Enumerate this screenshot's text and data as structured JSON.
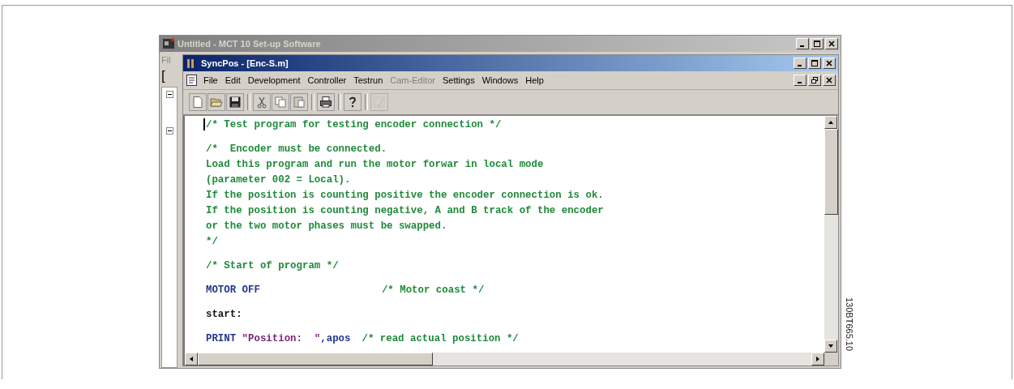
{
  "outer_window": {
    "title": "Untitled - MCT 10 Set-up Software",
    "active": false,
    "menu_fragment": "Fil",
    "toolbar_fragment": "["
  },
  "inner_window": {
    "title": "SyncPos - [Enc-S.m]",
    "active": true
  },
  "menu": [
    {
      "label": "File",
      "disabled": false
    },
    {
      "label": "Edit",
      "disabled": false
    },
    {
      "label": "Development",
      "disabled": false
    },
    {
      "label": "Controller",
      "disabled": false
    },
    {
      "label": "Testrun",
      "disabled": false
    },
    {
      "label": "Cam-Editor",
      "disabled": true
    },
    {
      "label": "Settings",
      "disabled": false
    },
    {
      "label": "Windows",
      "disabled": false
    },
    {
      "label": "Help",
      "disabled": false
    }
  ],
  "toolbar": [
    {
      "kind": "new",
      "separator_before": false,
      "disabled": false
    },
    {
      "kind": "open",
      "separator_before": false,
      "disabled": false
    },
    {
      "kind": "save",
      "separator_before": false,
      "disabled": false
    },
    {
      "kind": "cut",
      "separator_before": true,
      "disabled": false
    },
    {
      "kind": "copy",
      "separator_before": false,
      "disabled": false
    },
    {
      "kind": "paste",
      "separator_before": false,
      "disabled": false
    },
    {
      "kind": "print",
      "separator_before": true,
      "disabled": false
    },
    {
      "kind": "help",
      "separator_before": true,
      "disabled": false
    },
    {
      "kind": "check",
      "separator_before": true,
      "disabled": true
    }
  ],
  "editor": {
    "lines": [
      {
        "kind": "code",
        "cursor": true,
        "segments": [
          {
            "kind": "comment",
            "text": "/* Test program for testing encoder connection */"
          }
        ]
      },
      {
        "kind": "blank"
      },
      {
        "kind": "code",
        "cursor": false,
        "segments": [
          {
            "kind": "comment",
            "text": "/*  Encoder must be connected."
          }
        ]
      },
      {
        "kind": "code",
        "cursor": false,
        "segments": [
          {
            "kind": "comment",
            "text": "Load this program and run the motor forwar in local mode"
          }
        ]
      },
      {
        "kind": "code",
        "cursor": false,
        "segments": [
          {
            "kind": "comment",
            "text": "(parameter 002 = Local)."
          }
        ]
      },
      {
        "kind": "code",
        "cursor": false,
        "segments": [
          {
            "kind": "comment",
            "text": "If the position is counting positive the encoder connection is ok."
          }
        ]
      },
      {
        "kind": "code",
        "cursor": false,
        "segments": [
          {
            "kind": "comment",
            "text": "If the position is counting negative, A and B track of the encoder"
          }
        ]
      },
      {
        "kind": "code",
        "cursor": false,
        "segments": [
          {
            "kind": "comment",
            "text": "or the two motor phases must be swapped."
          }
        ]
      },
      {
        "kind": "code",
        "cursor": false,
        "segments": [
          {
            "kind": "comment",
            "text": "*/"
          }
        ]
      },
      {
        "kind": "blank"
      },
      {
        "kind": "code",
        "cursor": false,
        "segments": [
          {
            "kind": "comment",
            "text": "/* Start of program */"
          }
        ]
      },
      {
        "kind": "blank"
      },
      {
        "kind": "code",
        "cursor": false,
        "segments": [
          {
            "kind": "keyword",
            "text": "MOTOR OFF"
          },
          {
            "kind": "trailing_comment",
            "text": "/* Motor coast */"
          }
        ]
      },
      {
        "kind": "blank"
      },
      {
        "kind": "code",
        "cursor": false,
        "segments": [
          {
            "kind": "label",
            "text": "start:"
          }
        ]
      },
      {
        "kind": "blank"
      },
      {
        "kind": "code",
        "cursor": false,
        "segments": [
          {
            "kind": "keyword",
            "text": "PRINT"
          },
          {
            "kind": "string",
            "text": " \"Position:  \""
          },
          {
            "kind": "plain",
            "text": ",apos"
          },
          {
            "kind": "trailing_comment_near",
            "text": "/* read actual position */"
          }
        ]
      }
    ]
  },
  "figure_id": "130BT665.10"
}
